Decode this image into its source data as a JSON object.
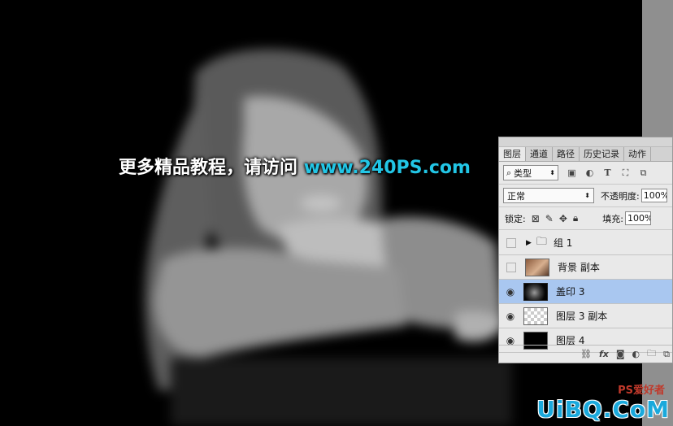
{
  "promo": {
    "text": "更多精品教程，请访问",
    "url": "www.240PS.com"
  },
  "panel": {
    "tabs": [
      "图层",
      "通道",
      "路径",
      "历史记录",
      "动作"
    ],
    "filter": {
      "kind": "类型"
    },
    "blend_mode": "正常",
    "opacity_label": "不透明度:",
    "opacity_value": "100%",
    "lock_label": "锁定:",
    "fill_label": "填充:",
    "fill_value": "100%",
    "layers": [
      {
        "name": "组 1",
        "visible": false,
        "type": "group"
      },
      {
        "name": "背景 副本",
        "visible": false,
        "type": "photo"
      },
      {
        "name": "盖印 3",
        "visible": true,
        "type": "dark",
        "selected": true
      },
      {
        "name": "图层 3 副本",
        "visible": true,
        "type": "checker"
      },
      {
        "name": "图层 4",
        "visible": true,
        "type": "black"
      }
    ],
    "bottom_icons": [
      "link-icon",
      "fx-icon",
      "mask-icon",
      "adjustment-icon",
      "folder-icon",
      "new-layer-icon"
    ]
  },
  "watermark": {
    "main": "UiBQ.CoM",
    "sub": "PS爱好者"
  },
  "colors": {
    "accent_url": "#22c6e6",
    "selected_layer": "#a9c7f0",
    "watermark": "#1aa9dc"
  }
}
